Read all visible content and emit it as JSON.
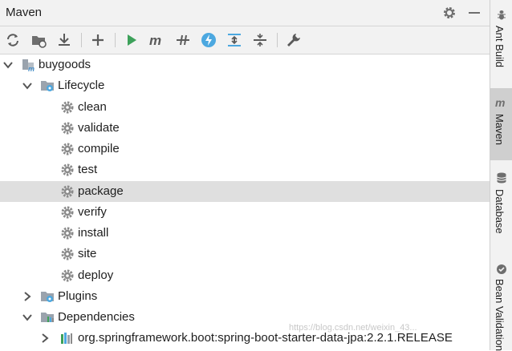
{
  "panel": {
    "title": "Maven"
  },
  "toolbar": {
    "icons": [
      "reload-icon",
      "add-maven-project-icon",
      "download-icon",
      "plus-icon",
      "run-icon",
      "execute-goal-icon",
      "toggle-offline-icon",
      "lightning-icon",
      "expand-all-icon",
      "collapse-all-icon",
      "wrench-icon"
    ]
  },
  "tree": {
    "project": "buygoods",
    "lifecycle": "Lifecycle",
    "goals": [
      "clean",
      "validate",
      "compile",
      "test",
      "package",
      "verify",
      "install",
      "site",
      "deploy"
    ],
    "plugins": "Plugins",
    "dependencies": "Dependencies",
    "dependency_item": "org.springframework.boot:spring-boot-starter-data-jpa:2.2.1.RELEASE"
  },
  "sidebar": {
    "tabs": [
      "Ant Build",
      "Maven",
      "Database",
      "Bean Validation"
    ],
    "active": "Maven"
  },
  "watermark": "https://blog.csdn.net/weixin_43..."
}
